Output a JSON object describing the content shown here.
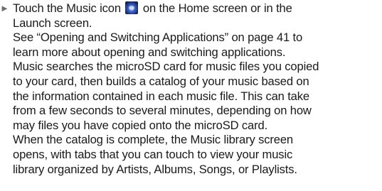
{
  "instruction": {
    "bullet": "►",
    "line1_before_icon": "Touch the Music icon",
    "icon": "music-app-icon",
    "line1_after_icon": "on the Home screen or in the",
    "line2": "Launch screen."
  },
  "paragraphs": [
    [
      "See “Opening and Switching Applications” on page 41 to",
      "learn more about opening and switching applications."
    ],
    [
      "Music searches the microSD card for music files you copied",
      "to your card, then builds a catalog of your music based on",
      "the information contained in each music file. This can take",
      "from a few seconds to several minutes, depending on how",
      "may files you have copied onto the microSD card."
    ],
    [
      "When the catalog is complete, the Music library screen",
      "opens, with tabs that you can touch to view your music",
      "library organized by Artists, Albums, Songs, or Playlists."
    ]
  ]
}
